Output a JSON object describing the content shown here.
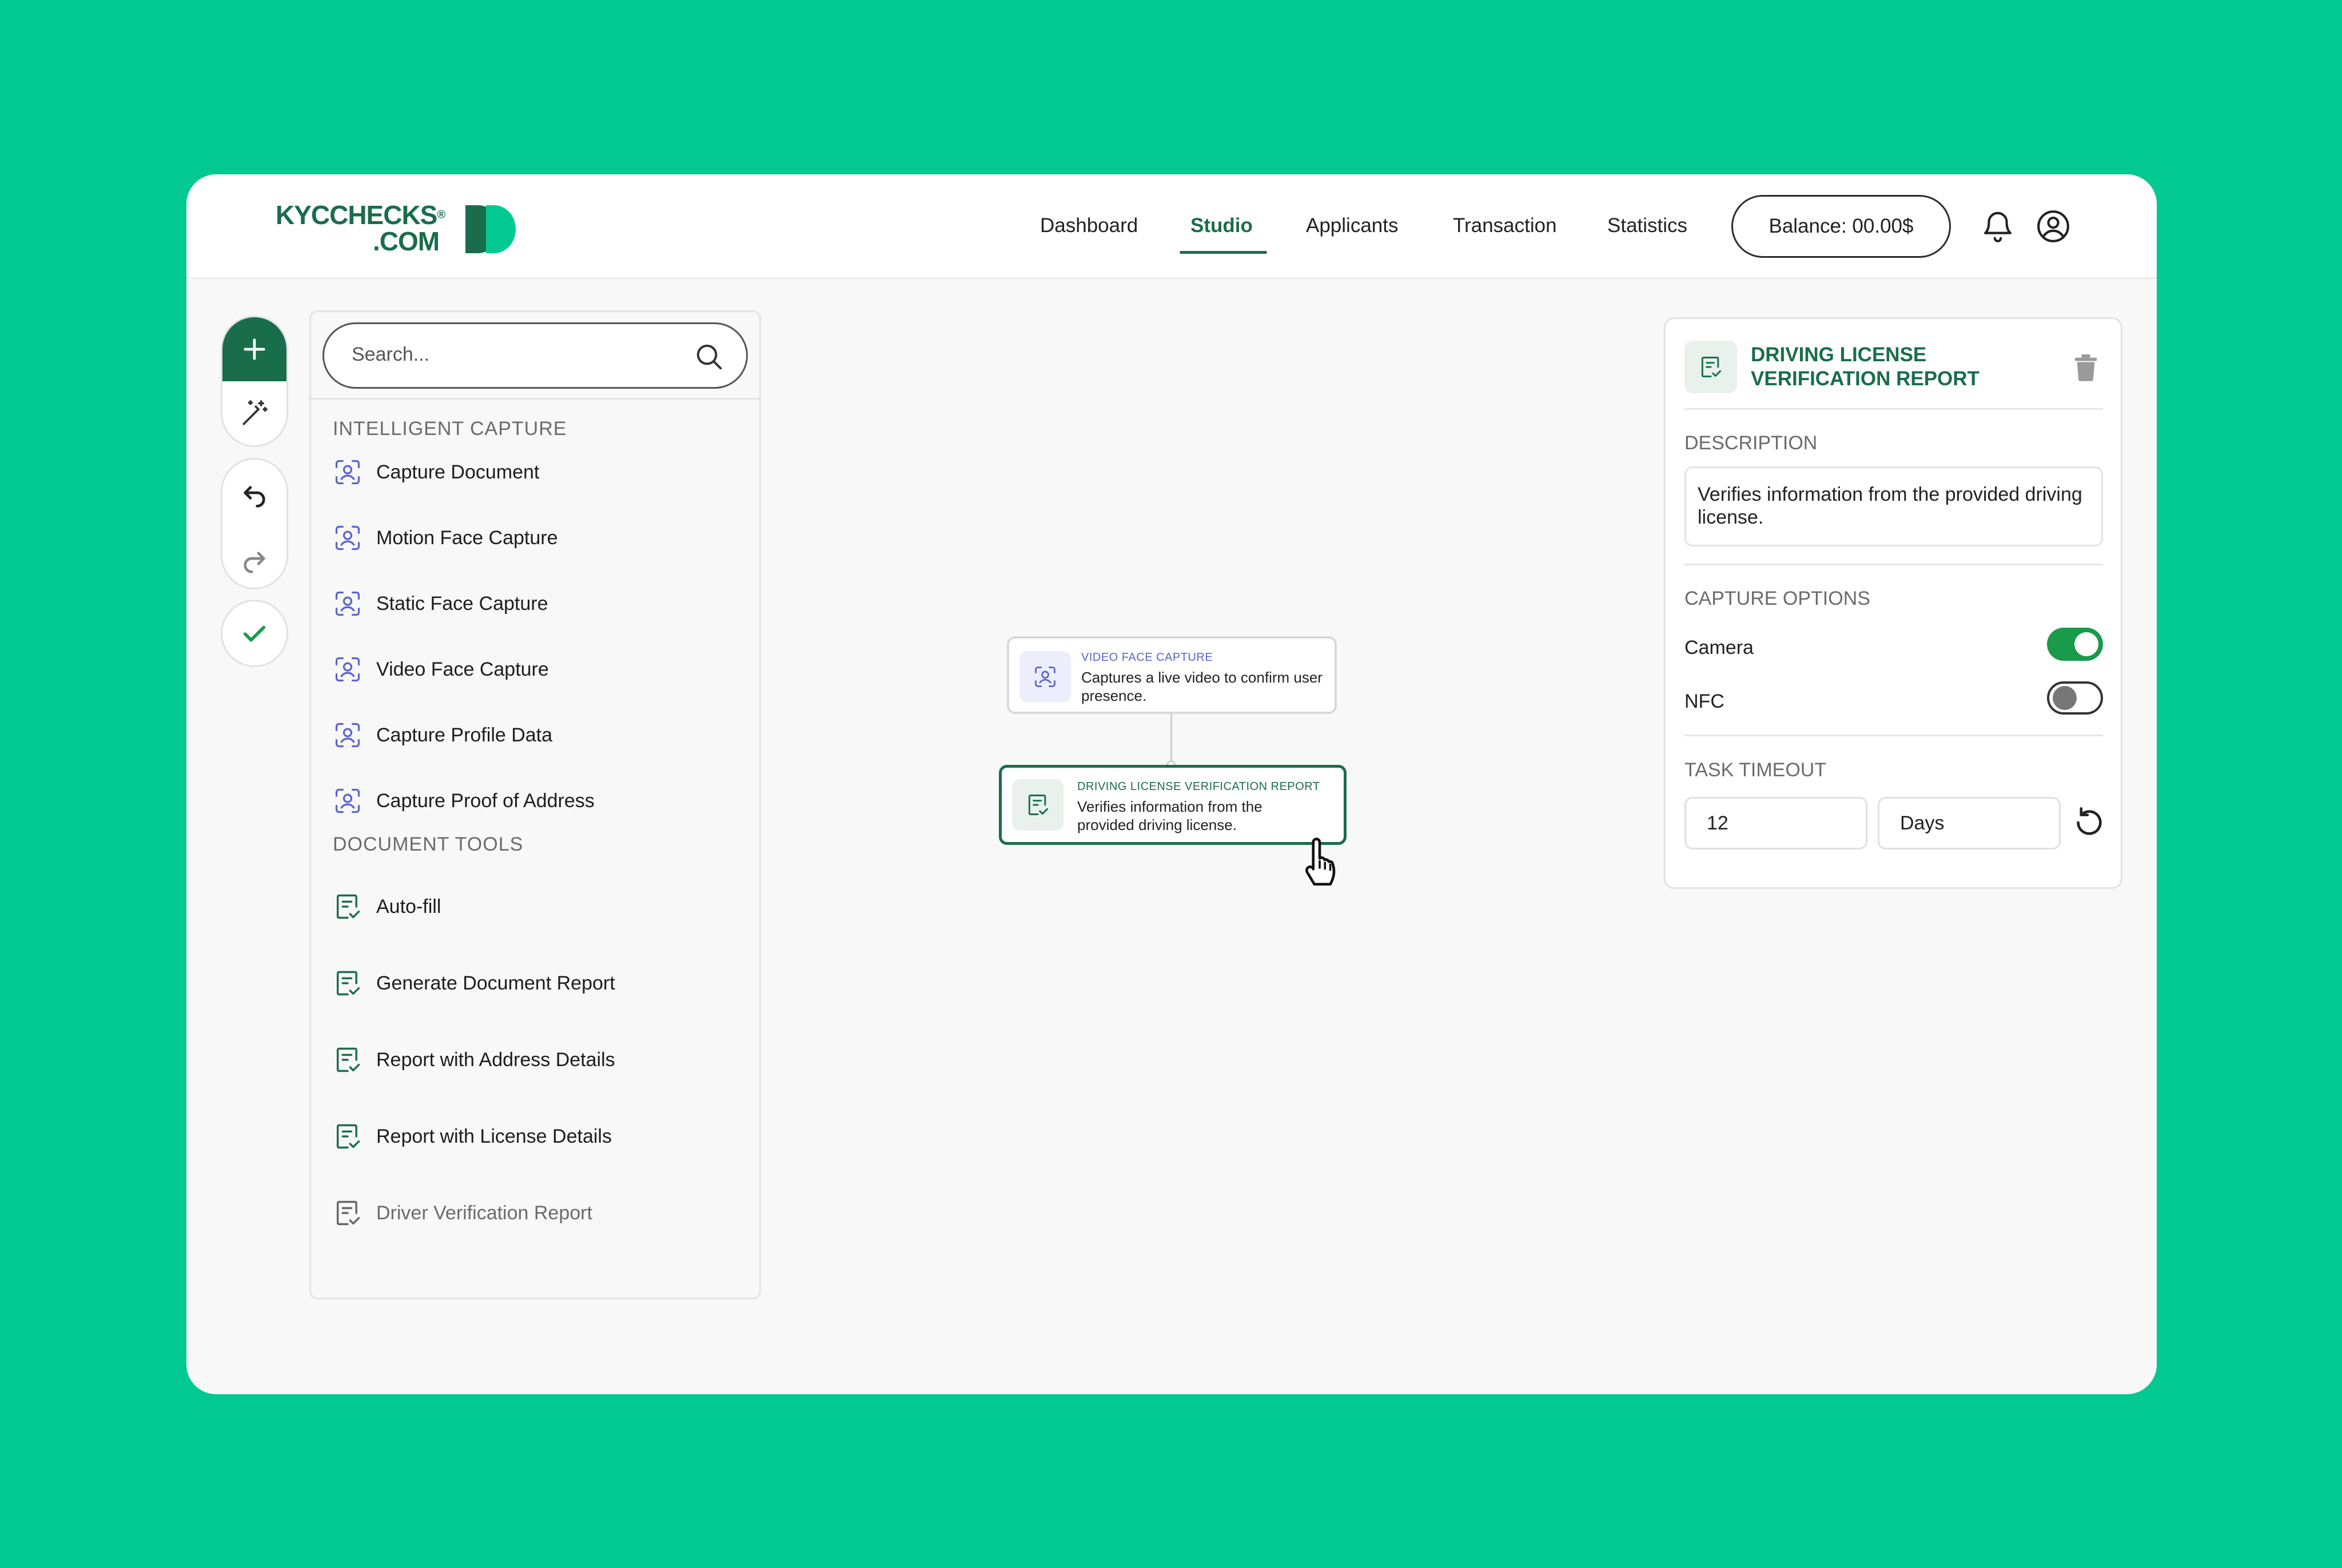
{
  "brand": {
    "line1": "KYCCHECKS",
    "reg": "®",
    "line2": ".COM"
  },
  "nav": {
    "items": [
      "Dashboard",
      "Studio",
      "Applicants",
      "Transaction",
      "Statistics"
    ],
    "active": "Studio",
    "balance": "Balance: 00.00$"
  },
  "icons": {
    "notifications": "bell-icon",
    "profile": "user-circle-icon",
    "add": "plus-icon",
    "magic": "magic-wand-icon",
    "undo": "undo-icon",
    "redo": "redo-icon",
    "confirm": "check-icon",
    "capture": "face-scan-icon",
    "document": "document-check-icon"
  },
  "colors": {
    "brand_green": "#1a6d4b",
    "background": "#02c892",
    "capture_purple": "#5b63d3",
    "toggle_on": "#1a9a4b"
  },
  "library": {
    "search_placeholder": "Search...",
    "intelligent_capture": {
      "title": "INTELLIGENT CAPTURE",
      "items": [
        "Capture Document",
        "Motion Face Capture",
        "Static Face Capture",
        "Video Face Capture",
        "Capture Profile Data",
        "Capture Proof of Address"
      ]
    },
    "document_tools": {
      "title": "DOCUMENT TOOLS",
      "items": [
        "Auto-fill",
        "Generate Document Report",
        "Report with Address Details",
        "Report with License Details",
        "Driver Verification Report"
      ]
    }
  },
  "canvas": {
    "nodes": [
      {
        "title": "VIDEO FACE CAPTURE",
        "description": "Captures a live video to confirm user presence."
      },
      {
        "title": "DRIVING LICENSE VERIFICATION REPORT",
        "description": "Verifies information from the provided driving license."
      }
    ]
  },
  "inspector": {
    "title": "DRIVING LICENSE VERIFICATION REPORT",
    "description_label": "DESCRIPTION",
    "description": "Verifies information from the provided driving license.",
    "capture_options_label": "CAPTURE OPTIONS",
    "options": [
      {
        "label": "Camera",
        "enabled": true
      },
      {
        "label": "NFC",
        "enabled": false
      }
    ],
    "timeout_label": "TASK TIMEOUT",
    "timeout_value": "12",
    "timeout_unit": "Days"
  }
}
